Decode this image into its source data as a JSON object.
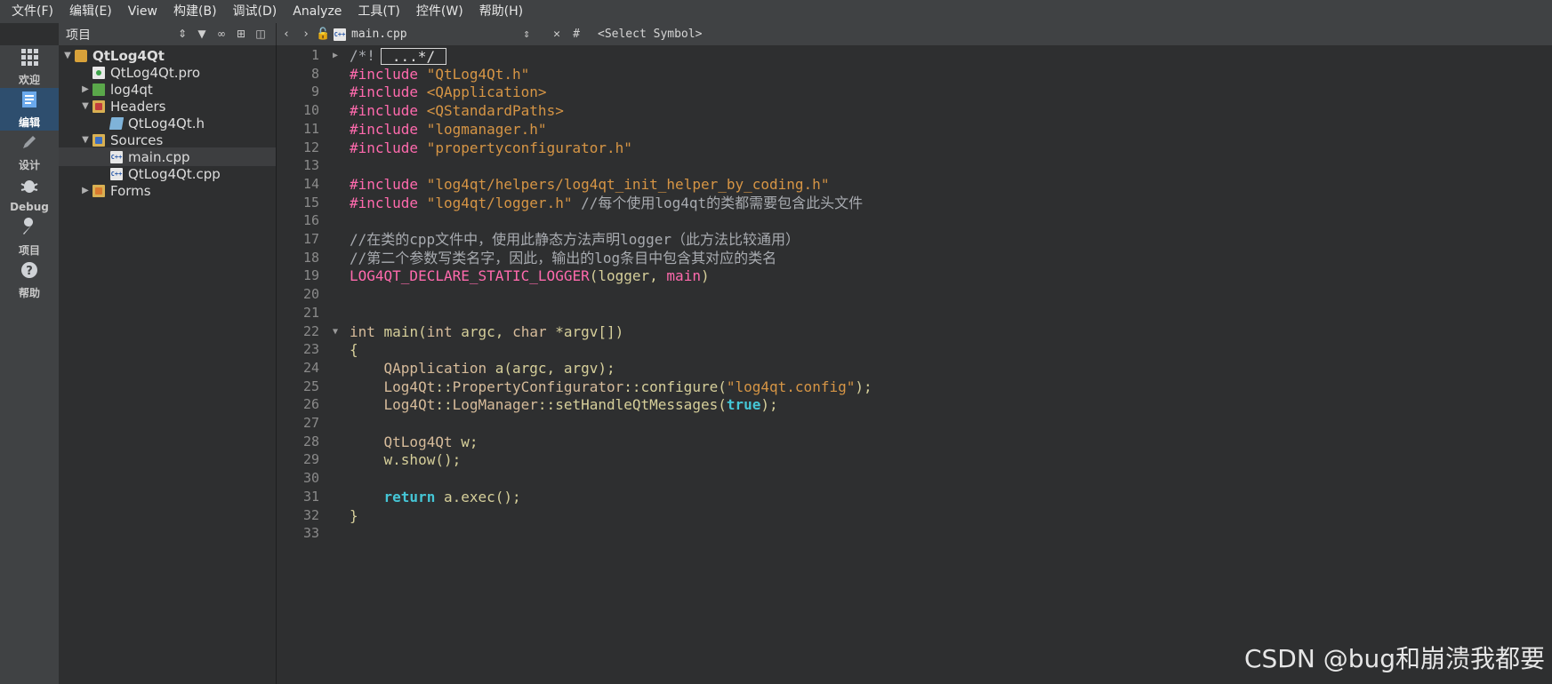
{
  "menubar": {
    "items": [
      "文件(F)",
      "编辑(E)",
      "View",
      "构建(B)",
      "调试(D)",
      "Analyze",
      "工具(T)",
      "控件(W)",
      "帮助(H)"
    ]
  },
  "modebar": {
    "modes": [
      {
        "label": "欢迎",
        "icon": "grid-icon"
      },
      {
        "label": "编辑",
        "icon": "edit-document-icon"
      },
      {
        "label": "设计",
        "icon": "pencil-icon"
      },
      {
        "label": "Debug",
        "icon": "bug-icon"
      },
      {
        "label": "项目",
        "icon": "wrench-icon"
      },
      {
        "label": "帮助",
        "icon": "help-icon"
      }
    ],
    "active_index": 1
  },
  "project_pane": {
    "title": "项目",
    "tree": [
      {
        "label": "QtLog4Qt",
        "level": 0,
        "arrow": "▼",
        "icon": "proj"
      },
      {
        "label": "QtLog4Qt.pro",
        "level": 1,
        "arrow": "",
        "icon": "pro"
      },
      {
        "label": "log4qt",
        "level": 1,
        "arrow": "▶",
        "icon": "sub"
      },
      {
        "label": "Headers",
        "level": 1,
        "arrow": "▼",
        "icon": "folder hdr"
      },
      {
        "label": "QtLog4Qt.h",
        "level": 2,
        "arrow": "",
        "icon": "hfile"
      },
      {
        "label": "Sources",
        "level": 1,
        "arrow": "▼",
        "icon": "folder src"
      },
      {
        "label": "main.cpp",
        "level": 2,
        "arrow": "",
        "icon": "cpp"
      },
      {
        "label": "QtLog4Qt.cpp",
        "level": 2,
        "arrow": "",
        "icon": "cpp"
      },
      {
        "label": "Forms",
        "level": 1,
        "arrow": "▶",
        "icon": "folder frm"
      }
    ],
    "selected_index": 6
  },
  "editor_toolbar": {
    "file_name": "main.cpp",
    "symbol_placeholder": "<Select Symbol>",
    "hash": "#"
  },
  "editor": {
    "lines": [
      {
        "n": "1",
        "fold": "▶",
        "collapsed": "...*/",
        "prefix": "/*!"
      },
      {
        "n": "8",
        "html": [
          [
            "kw-pre",
            "#include "
          ],
          [
            "str",
            "\"QtLog4Qt.h\""
          ]
        ]
      },
      {
        "n": "9",
        "html": [
          [
            "kw-pre",
            "#include "
          ],
          [
            "inc",
            "<QApplication>"
          ]
        ]
      },
      {
        "n": "10",
        "html": [
          [
            "kw-pre",
            "#include "
          ],
          [
            "inc",
            "<QStandardPaths>"
          ]
        ]
      },
      {
        "n": "11",
        "html": [
          [
            "kw-pre",
            "#include "
          ],
          [
            "str",
            "\"logmanager.h\""
          ]
        ]
      },
      {
        "n": "12",
        "html": [
          [
            "kw-pre",
            "#include "
          ],
          [
            "str",
            "\"propertyconfigurator.h\""
          ]
        ]
      },
      {
        "n": "13",
        "html": []
      },
      {
        "n": "14",
        "html": [
          [
            "kw-pre",
            "#include "
          ],
          [
            "str",
            "\"log4qt/helpers/log4qt_init_helper_by_coding.h\""
          ]
        ]
      },
      {
        "n": "15",
        "html": [
          [
            "kw-pre",
            "#include "
          ],
          [
            "str",
            "\"log4qt/logger.h\""
          ],
          [
            "plain",
            " "
          ],
          [
            "cmt",
            "//每个使用log4qt的类都需要包含此头文件"
          ]
        ]
      },
      {
        "n": "16",
        "html": []
      },
      {
        "n": "17",
        "html": [
          [
            "cmt",
            "//在类的cpp文件中，使用此静态方法声明logger（此方法比较通用）"
          ]
        ]
      },
      {
        "n": "18",
        "html": [
          [
            "cmt",
            "//第二个参数写类名字，因此，输出的log条目中包含其对应的类名"
          ]
        ]
      },
      {
        "n": "19",
        "html": [
          [
            "macro",
            "LOG4QT_DECLARE_STATIC_LOGGER"
          ],
          [
            "plain",
            "(logger, "
          ],
          [
            "macro",
            "main"
          ],
          [
            "plain",
            ")"
          ]
        ]
      },
      {
        "n": "20",
        "html": []
      },
      {
        "n": "21",
        "html": []
      },
      {
        "n": "22",
        "fold": "▼",
        "html": [
          [
            "type",
            "int"
          ],
          [
            "plain",
            " "
          ],
          [
            "fn",
            "main"
          ],
          [
            "plain",
            "("
          ],
          [
            "type",
            "int"
          ],
          [
            "plain",
            " argc, "
          ],
          [
            "type",
            "char"
          ],
          [
            "plain",
            " *argv[])"
          ]
        ]
      },
      {
        "n": "23",
        "html": [
          [
            "plain",
            "{"
          ]
        ]
      },
      {
        "n": "24",
        "html": [
          [
            "plain",
            "    "
          ],
          [
            "type",
            "QApplication"
          ],
          [
            "plain",
            " a(argc, argv);"
          ]
        ]
      },
      {
        "n": "25",
        "html": [
          [
            "plain",
            "    "
          ],
          [
            "type",
            "Log4Qt"
          ],
          [
            "plain",
            "::"
          ],
          [
            "type",
            "PropertyConfigurator"
          ],
          [
            "plain",
            "::"
          ],
          [
            "fn",
            "configure"
          ],
          [
            "plain",
            "("
          ],
          [
            "str",
            "\"log4qt.config\""
          ],
          [
            "plain",
            ");"
          ]
        ]
      },
      {
        "n": "26",
        "html": [
          [
            "plain",
            "    "
          ],
          [
            "type",
            "Log4Qt"
          ],
          [
            "plain",
            "::"
          ],
          [
            "type",
            "LogManager"
          ],
          [
            "plain",
            "::"
          ],
          [
            "fn",
            "setHandleQtMessages"
          ],
          [
            "plain",
            "("
          ],
          [
            "kw",
            "true"
          ],
          [
            "plain",
            ");"
          ]
        ]
      },
      {
        "n": "27",
        "html": []
      },
      {
        "n": "28",
        "html": [
          [
            "plain",
            "    "
          ],
          [
            "type",
            "QtLog4Qt"
          ],
          [
            "plain",
            " w;"
          ]
        ]
      },
      {
        "n": "29",
        "html": [
          [
            "plain",
            "    w."
          ],
          [
            "fn",
            "show"
          ],
          [
            "plain",
            "();"
          ]
        ]
      },
      {
        "n": "30",
        "html": []
      },
      {
        "n": "31",
        "html": [
          [
            "plain",
            "    "
          ],
          [
            "kw",
            "return"
          ],
          [
            "plain",
            " a."
          ],
          [
            "fn",
            "exec"
          ],
          [
            "plain",
            "();"
          ]
        ]
      },
      {
        "n": "32",
        "html": [
          [
            "plain",
            "}"
          ]
        ]
      },
      {
        "n": "33",
        "html": []
      }
    ]
  },
  "watermark": "CSDN @bug和崩溃我都要",
  "colors": {
    "background": "#2e2f30",
    "panel": "#404244",
    "preprocessor": "#ff6aad",
    "string": "#d69545",
    "keyword": "#45c6d6",
    "comment": "#a8abb0"
  }
}
